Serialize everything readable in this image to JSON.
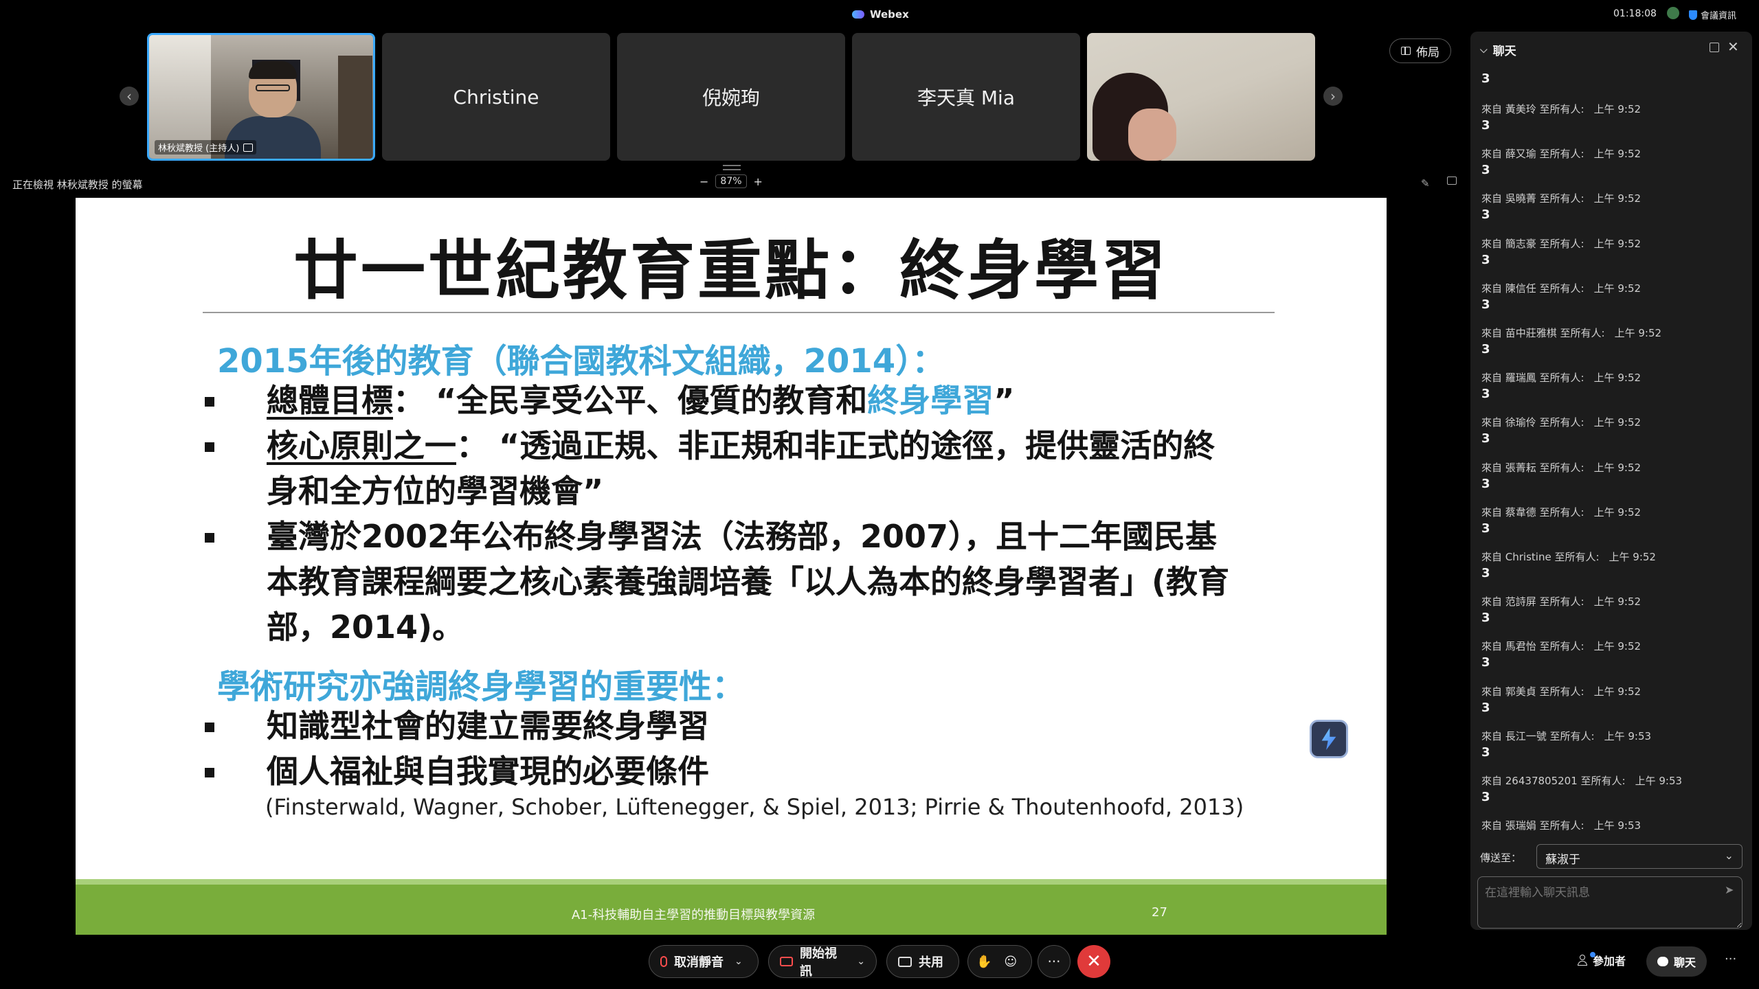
{
  "app": {
    "title": "Webex",
    "timer": "01:18:08",
    "meeting_info": "會議資訊"
  },
  "participants": {
    "host_name": "林秋斌教授 (主持人)",
    "tiles": [
      "Christine",
      "倪婉珣",
      "李天真 Mia"
    ]
  },
  "layout_button": "佈局",
  "viewing": {
    "text": "正在檢視 林秋斌教授 的螢幕",
    "zoom": "87%"
  },
  "slide": {
    "title": "廿一世紀教育重點：終身學習",
    "heading1": "2015年後的教育（聯合國教科文組織，2014）：",
    "b1_label": "總體目標",
    "b1_sep": "：",
    "b1_text_a": "“全民享受公平、優質的教育和",
    "b1_highlight": "終身學習",
    "b1_text_b": "”",
    "b2_label": "核心原則之一",
    "b2_sep": "：",
    "b2_text_a": "“透過正規、非正規和非正式的途徑，提供靈活的終",
    "b2_text_b": "身和全方位的學習機會”",
    "b3_line1": "臺灣於2002年公布終身學習法（法務部，2007），且十二年國民基",
    "b3_line2": "本教育課程綱要之核心素養強調培養「以人為本的終身學習者」(教育",
    "b3_line3": "部，2014)。",
    "heading2": "學術研究亦強調終身學習的重要性：",
    "b4": "知識型社會的建立需要終身學習",
    "b5": "個人福祉與自我實現的必要條件",
    "citation": "(Finsterwald, Wagner, Schober, Lüftenegger, & Spiel, 2013; Pirrie & Thoutenhoofd, 2013)",
    "footer": "A1-科技輔助自主學習的推動目標與教學資源",
    "page": "27"
  },
  "chat": {
    "title": "聊天",
    "first_body": "3",
    "messages": [
      {
        "sender": "來自 黃美玲 至所有人:",
        "time": "上午 9:52",
        "body": "3"
      },
      {
        "sender": "來自 薛又瑜 至所有人:",
        "time": "上午 9:52",
        "body": "3"
      },
      {
        "sender": "來自 吳曉菁 至所有人:",
        "time": "上午 9:52",
        "body": "3"
      },
      {
        "sender": "來自 簡志豪 至所有人:",
        "time": "上午 9:52",
        "body": "3"
      },
      {
        "sender": "來自 陳信任 至所有人:",
        "time": "上午 9:52",
        "body": "3"
      },
      {
        "sender": "來自 苗中莊雅棋 至所有人:",
        "time": "上午 9:52",
        "body": "3"
      },
      {
        "sender": "來自 羅瑞鳳 至所有人:",
        "time": "上午 9:52",
        "body": "3"
      },
      {
        "sender": "來自 徐瑜伶 至所有人:",
        "time": "上午 9:52",
        "body": "3"
      },
      {
        "sender": "來自 張菁耘 至所有人:",
        "time": "上午 9:52",
        "body": "3"
      },
      {
        "sender": "來自 蔡韋德 至所有人:",
        "time": "上午 9:52",
        "body": "3"
      },
      {
        "sender": "來自 Christine 至所有人:",
        "time": "上午 9:52",
        "body": "3"
      },
      {
        "sender": "來自 范詩屏 至所有人:",
        "time": "上午 9:52",
        "body": "3"
      },
      {
        "sender": "來自 馬君怡 至所有人:",
        "time": "上午 9:52",
        "body": "3"
      },
      {
        "sender": "來自 郭美貞 至所有人:",
        "time": "上午 9:52",
        "body": "3"
      },
      {
        "sender": "來自 長江一號 至所有人:",
        "time": "上午 9:53",
        "body": "3"
      },
      {
        "sender": "來自 26437805201 至所有人:",
        "time": "上午 9:53",
        "body": "3"
      },
      {
        "sender": "來自 張瑞娟 至所有人:",
        "time": "上午 9:53",
        "body": ""
      }
    ],
    "send_to_label": "傳送至：",
    "send_to_value": "蘇淑于",
    "input_placeholder": "在這裡輸入聊天訊息"
  },
  "controls": {
    "unmute": "取消靜音",
    "start_video": "開始視訊",
    "share": "共用",
    "more": "···",
    "participants": "參加者",
    "chat": "聊天"
  },
  "colors": {
    "accent": "#3fa7d9",
    "slide_footer": "#79ad3b",
    "end_call": "#e03a3a"
  }
}
